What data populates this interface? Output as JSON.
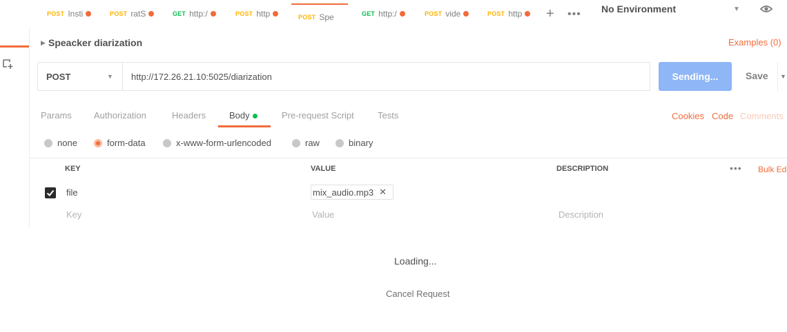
{
  "tabs": [
    {
      "method": "POST",
      "name": "Insti",
      "active": false
    },
    {
      "method": "POST",
      "name": "ratS",
      "active": false
    },
    {
      "method": "GET",
      "name": "http:/",
      "active": false
    },
    {
      "method": "POST",
      "name": "http",
      "active": false
    },
    {
      "method": "POST",
      "name": "Spea",
      "active": true
    },
    {
      "method": "GET",
      "name": "http:/",
      "active": false
    },
    {
      "method": "POST",
      "name": "vide",
      "active": false
    },
    {
      "method": "POST",
      "name": "http",
      "active": false
    }
  ],
  "tab_actions": {
    "add": "+",
    "more": "•••"
  },
  "environment": {
    "selected": "No Environment"
  },
  "request": {
    "title": "Speacker diarization",
    "examples": "Examples (0)",
    "method": "POST",
    "url": "http://172.26.21.10:5025/diarization",
    "send_label": "Sending...",
    "save_label": "Save"
  },
  "subtabs": {
    "params": "Params",
    "authorization": "Authorization",
    "headers": "Headers",
    "body": "Body",
    "prerequest": "Pre-request Script",
    "tests": "Tests",
    "active": "Body"
  },
  "right_links": {
    "cookies": "Cookies",
    "code": "Code",
    "comments": "Comments"
  },
  "body_types": {
    "none": "none",
    "form_data": "form-data",
    "urlencoded": "x-www-form-urlencoded",
    "raw": "raw",
    "binary": "binary",
    "selected": "form-data"
  },
  "table": {
    "headers": {
      "key": "KEY",
      "value": "VALUE",
      "description": "DESCRIPTION"
    },
    "more": "•••",
    "bulk_edit": "Bulk Ed",
    "rows": [
      {
        "checked": true,
        "key": "file",
        "value": "mix_audio.mp3",
        "description": ""
      }
    ],
    "placeholders": {
      "key": "Key",
      "value": "Value",
      "description": "Description"
    }
  },
  "loading": {
    "text": "Loading...",
    "cancel": "Cancel Request"
  },
  "colors": {
    "accent": "#f26b3a",
    "post": "#ffb400",
    "get": "#0cbb52",
    "send": "#8fb6f6"
  }
}
